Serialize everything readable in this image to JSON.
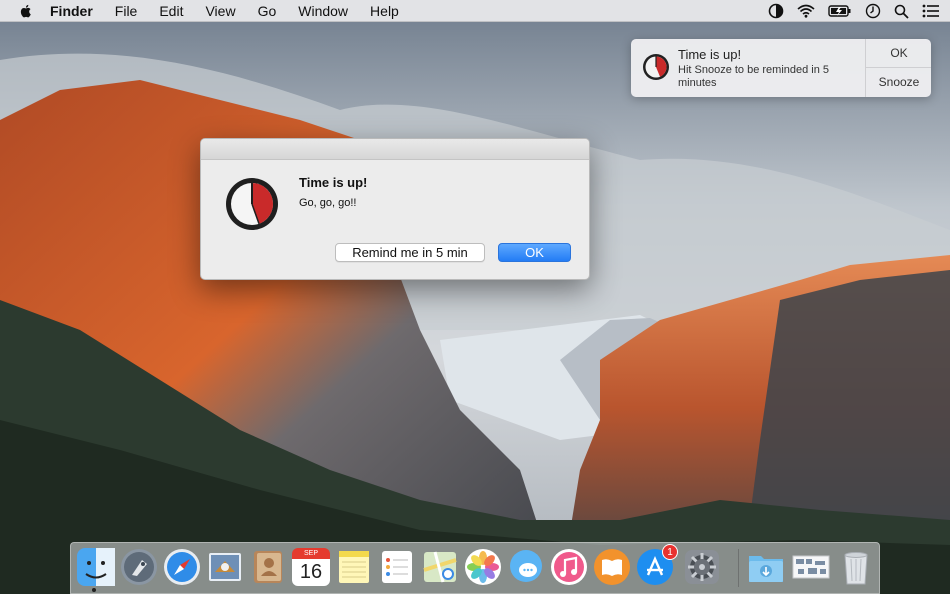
{
  "menubar": {
    "app_name": "Finder",
    "items": [
      "File",
      "Edit",
      "View",
      "Go",
      "Window",
      "Help"
    ],
    "status_icons": [
      "timer-icon",
      "wifi-icon",
      "battery-icon",
      "clock-icon",
      "spotlight-icon",
      "notification-center-icon"
    ]
  },
  "notification": {
    "title": "Time is up!",
    "body": "Hit Snooze to be reminded in 5 minutes",
    "ok_label": "OK",
    "snooze_label": "Snooze"
  },
  "dialog": {
    "title": "Time is up!",
    "message": "Go, go, go!!",
    "remind_label": "Remind me in 5 min",
    "ok_label": "OK"
  },
  "dock": {
    "calendar_month": "SEP",
    "calendar_day": "16",
    "app_store_badge": "1",
    "icons": [
      "finder-icon",
      "launchpad-icon",
      "safari-icon",
      "mail-icon",
      "contacts-icon",
      "calendar-icon",
      "notes-icon",
      "reminders-icon",
      "maps-icon",
      "photos-icon",
      "messages-icon",
      "itunes-icon",
      "ibooks-icon",
      "app-store-icon",
      "system-preferences-icon",
      "downloads-folder-icon",
      "preview-icon",
      "trash-icon"
    ]
  },
  "colors": {
    "accent": "#237cf5",
    "timer_red": "#c92a2a",
    "badge": "#e8322f"
  }
}
